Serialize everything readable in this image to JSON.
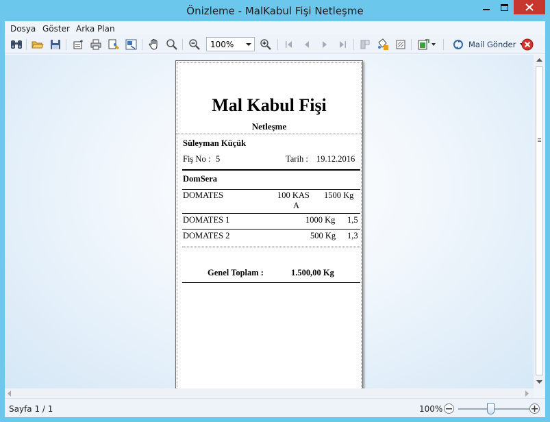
{
  "window": {
    "title": "Önizleme - MalKabul Fişi Netleşme"
  },
  "menu": {
    "items": [
      {
        "label": "Dosya"
      },
      {
        "label": "Göster"
      },
      {
        "label": "Arka Plan"
      }
    ]
  },
  "toolbar": {
    "zoom_value": "100%",
    "mail_label": "Mail Gönder",
    "icons": [
      "find-icon",
      "open-icon",
      "save-icon",
      "page-setup-icon",
      "print-icon",
      "quick-print-icon",
      "scale-icon",
      "hand-icon",
      "magnifier-icon",
      "zoom-out-icon",
      "zoom-in-icon",
      "first-page-icon",
      "prev-page-icon",
      "next-page-icon",
      "last-page-icon",
      "multipage-icon",
      "color-icon",
      "watermark-icon",
      "export-icon",
      "mail-icon",
      "close-preview-icon"
    ]
  },
  "report": {
    "title": "Mal Kabul Fişi",
    "subtitle": "Netleşme",
    "customer": "Süleyman Küçük",
    "fis_no_label": "Fiş No :",
    "fis_no": "5",
    "tarih_label": "Tarih :",
    "tarih": "19.12.2016",
    "section": "DomSera",
    "rows": [
      {
        "name": "DOMATES",
        "qty": "100 KAS",
        "qty2": "A",
        "weight": "1500 Kg",
        "extra": ""
      },
      {
        "name": "DOMATES 1",
        "qty": "",
        "qty2": "",
        "weight": "1000 Kg",
        "extra": "1,5"
      },
      {
        "name": "DOMATES 2",
        "qty": "",
        "qty2": "",
        "weight": "500 Kg",
        "extra": "1,3"
      }
    ],
    "total_label": "Genel Toplam :",
    "total_value": "1.500,00 Kg"
  },
  "status": {
    "page": "Sayfa 1 / 1",
    "zoom": "100%",
    "zoom_level_percent": 100
  },
  "colors": {
    "titlebar": "#6cc7ec",
    "close_button": "#c7372f",
    "mail_close_icon": "#d9322c"
  }
}
